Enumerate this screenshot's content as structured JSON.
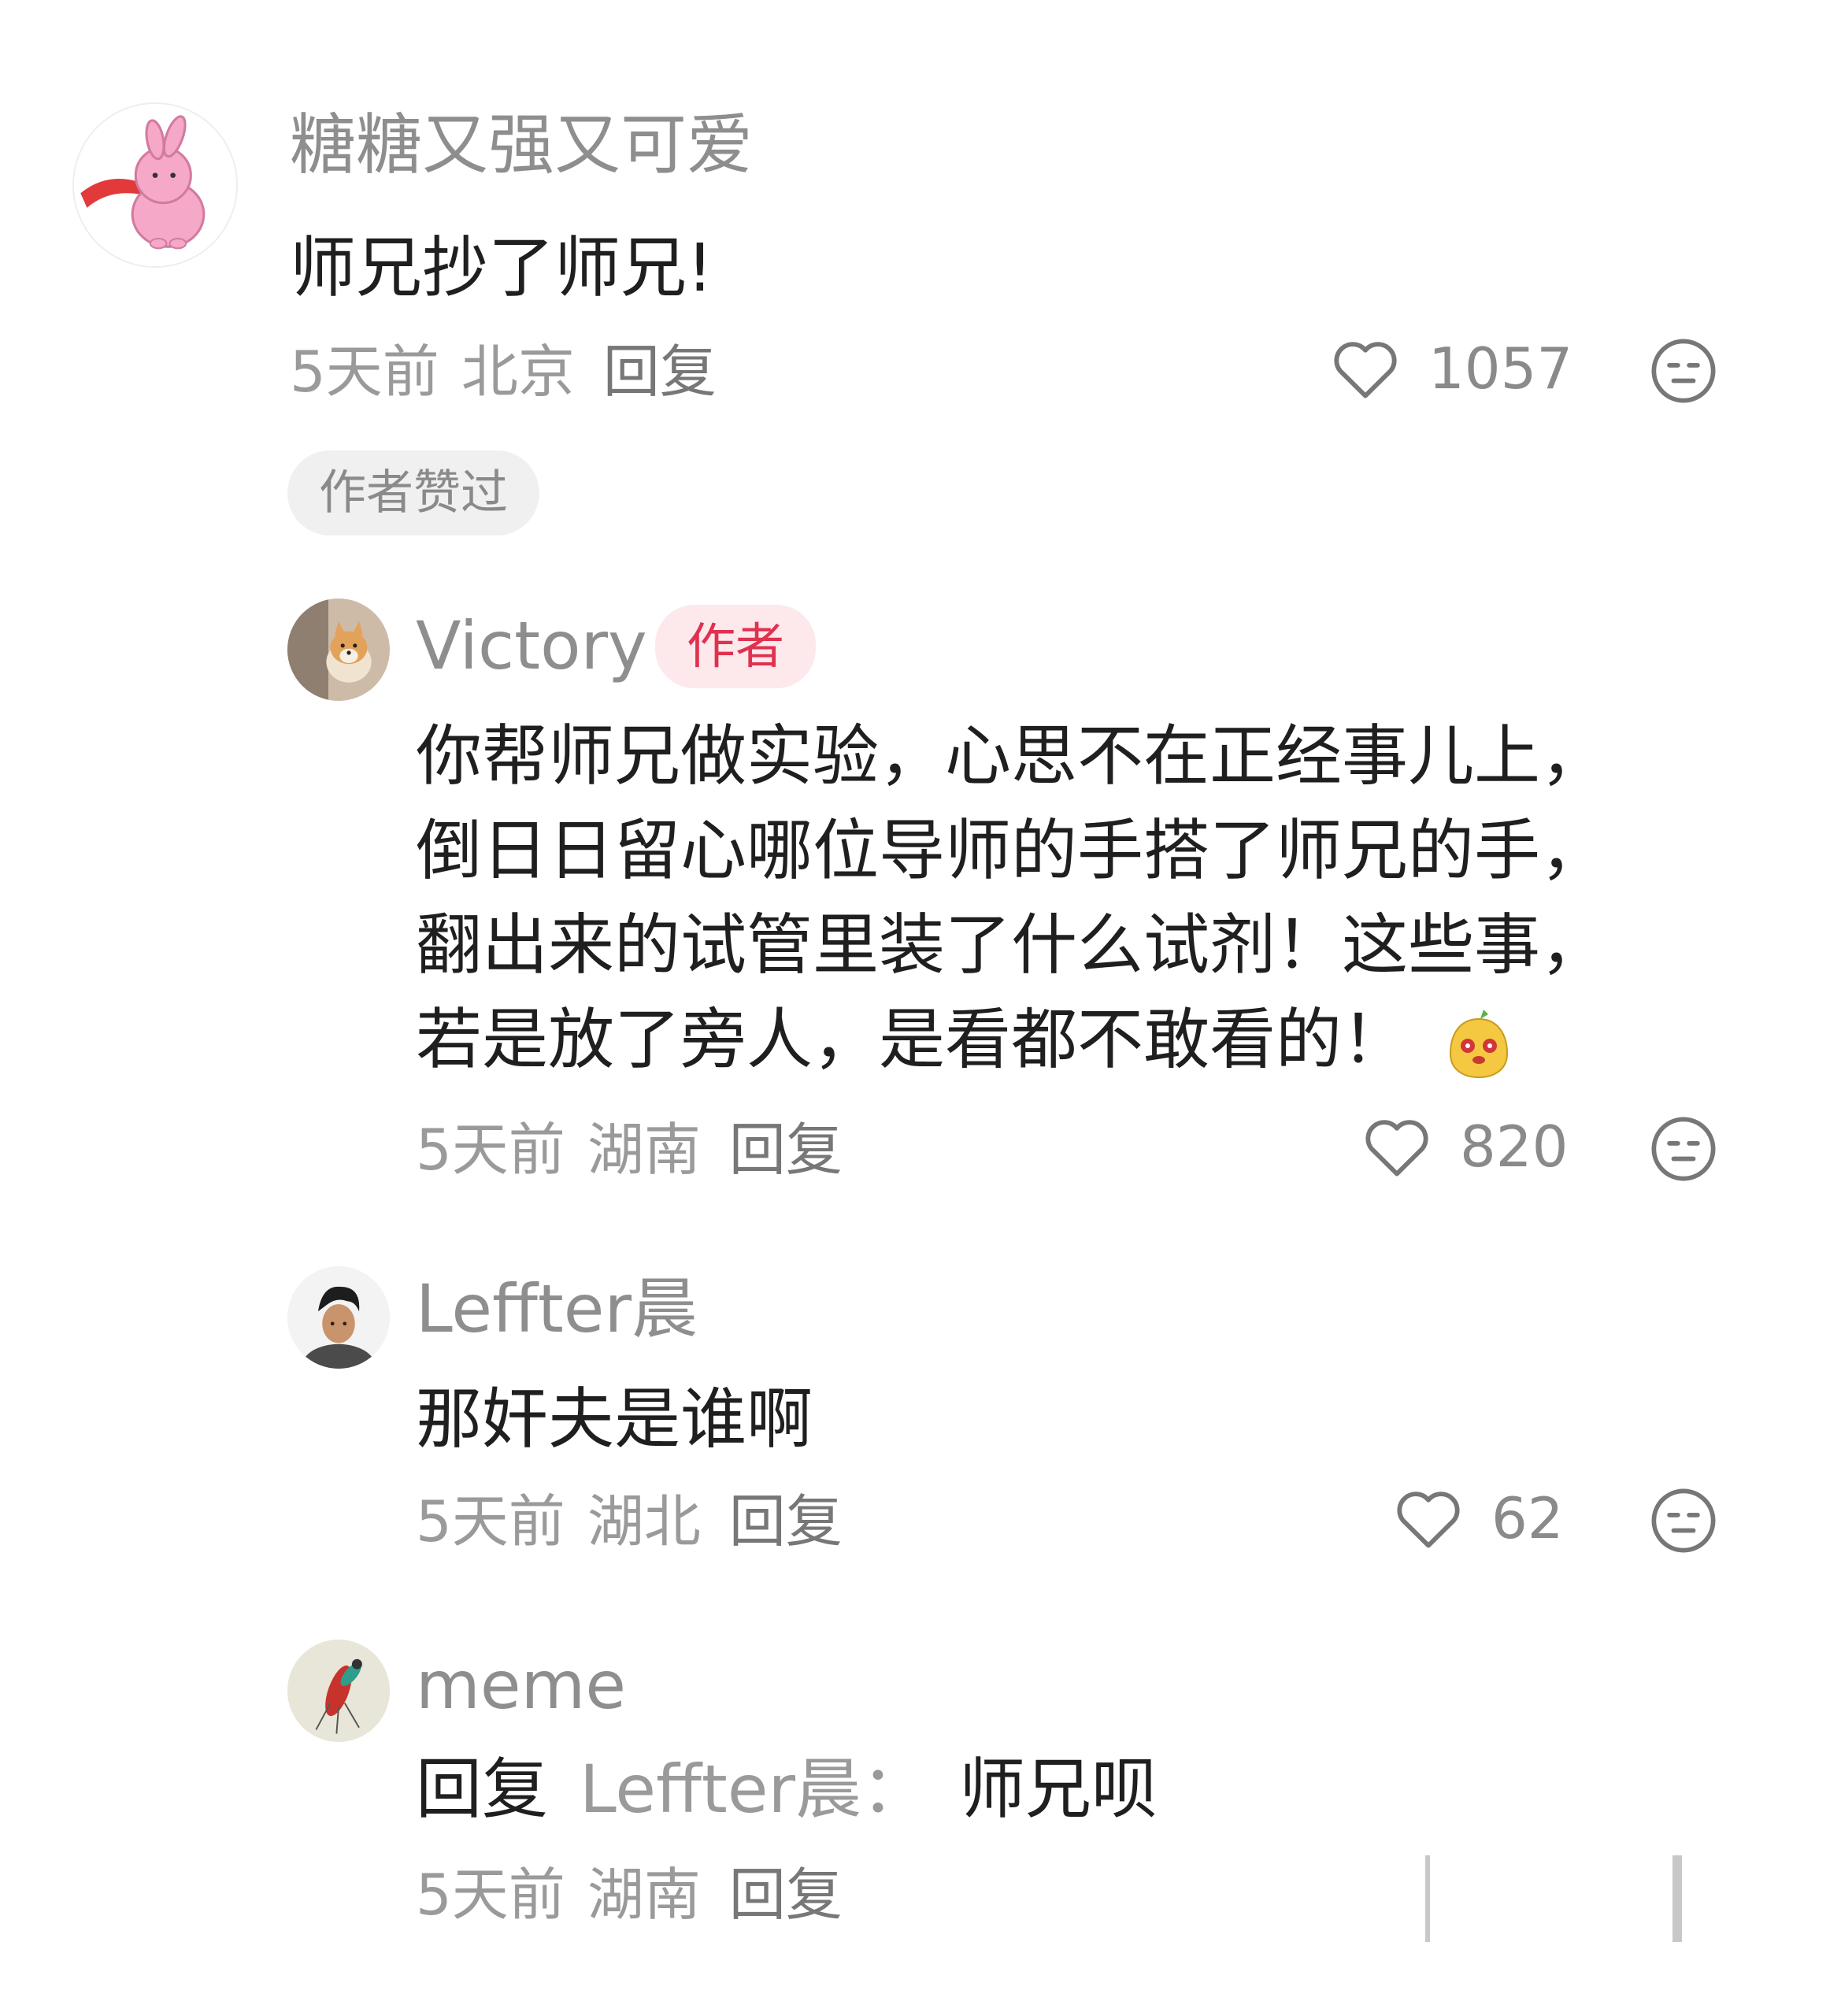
{
  "comments": [
    {
      "username": "糖糖又强又可爱",
      "text": "师兄抄了师兄!",
      "time": "5天前",
      "region": "北京",
      "reply_label": "回复",
      "likes": "1057",
      "badge": "作者赞过"
    },
    {
      "username": "Victory",
      "author_tag": "作者",
      "text_lines": [
        "你帮师兄做实验，心思不在正经事儿上，",
        "倒日日留心哪位导师的手搭了师兄的手，",
        "翻出来的试管里装了什么试剂！这些事，",
        "若是放了旁人，是看都不敢看的！"
      ],
      "time": "5天前",
      "region": "湖南",
      "reply_label": "回复",
      "likes": "820"
    },
    {
      "username": "Leffter晨",
      "text": "那奸夫是谁啊",
      "time": "5天前",
      "region": "湖北",
      "reply_label": "回复",
      "likes": "62"
    },
    {
      "username": "meme",
      "reply_prefix": "回复",
      "reply_target": "Leffter晨：",
      "reply_body": "师兄呗",
      "time": "5天前",
      "region": "湖南",
      "reply_label": "回复"
    }
  ],
  "icons": {
    "like": "heart-outline-icon",
    "dislike": "neutral-face-icon",
    "emoji": "yellow-creature-emoji"
  },
  "colors": {
    "author_tag_bg": "#fde8ec",
    "author_tag_text": "#e0314f",
    "muted_text": "#9a9a9a"
  }
}
